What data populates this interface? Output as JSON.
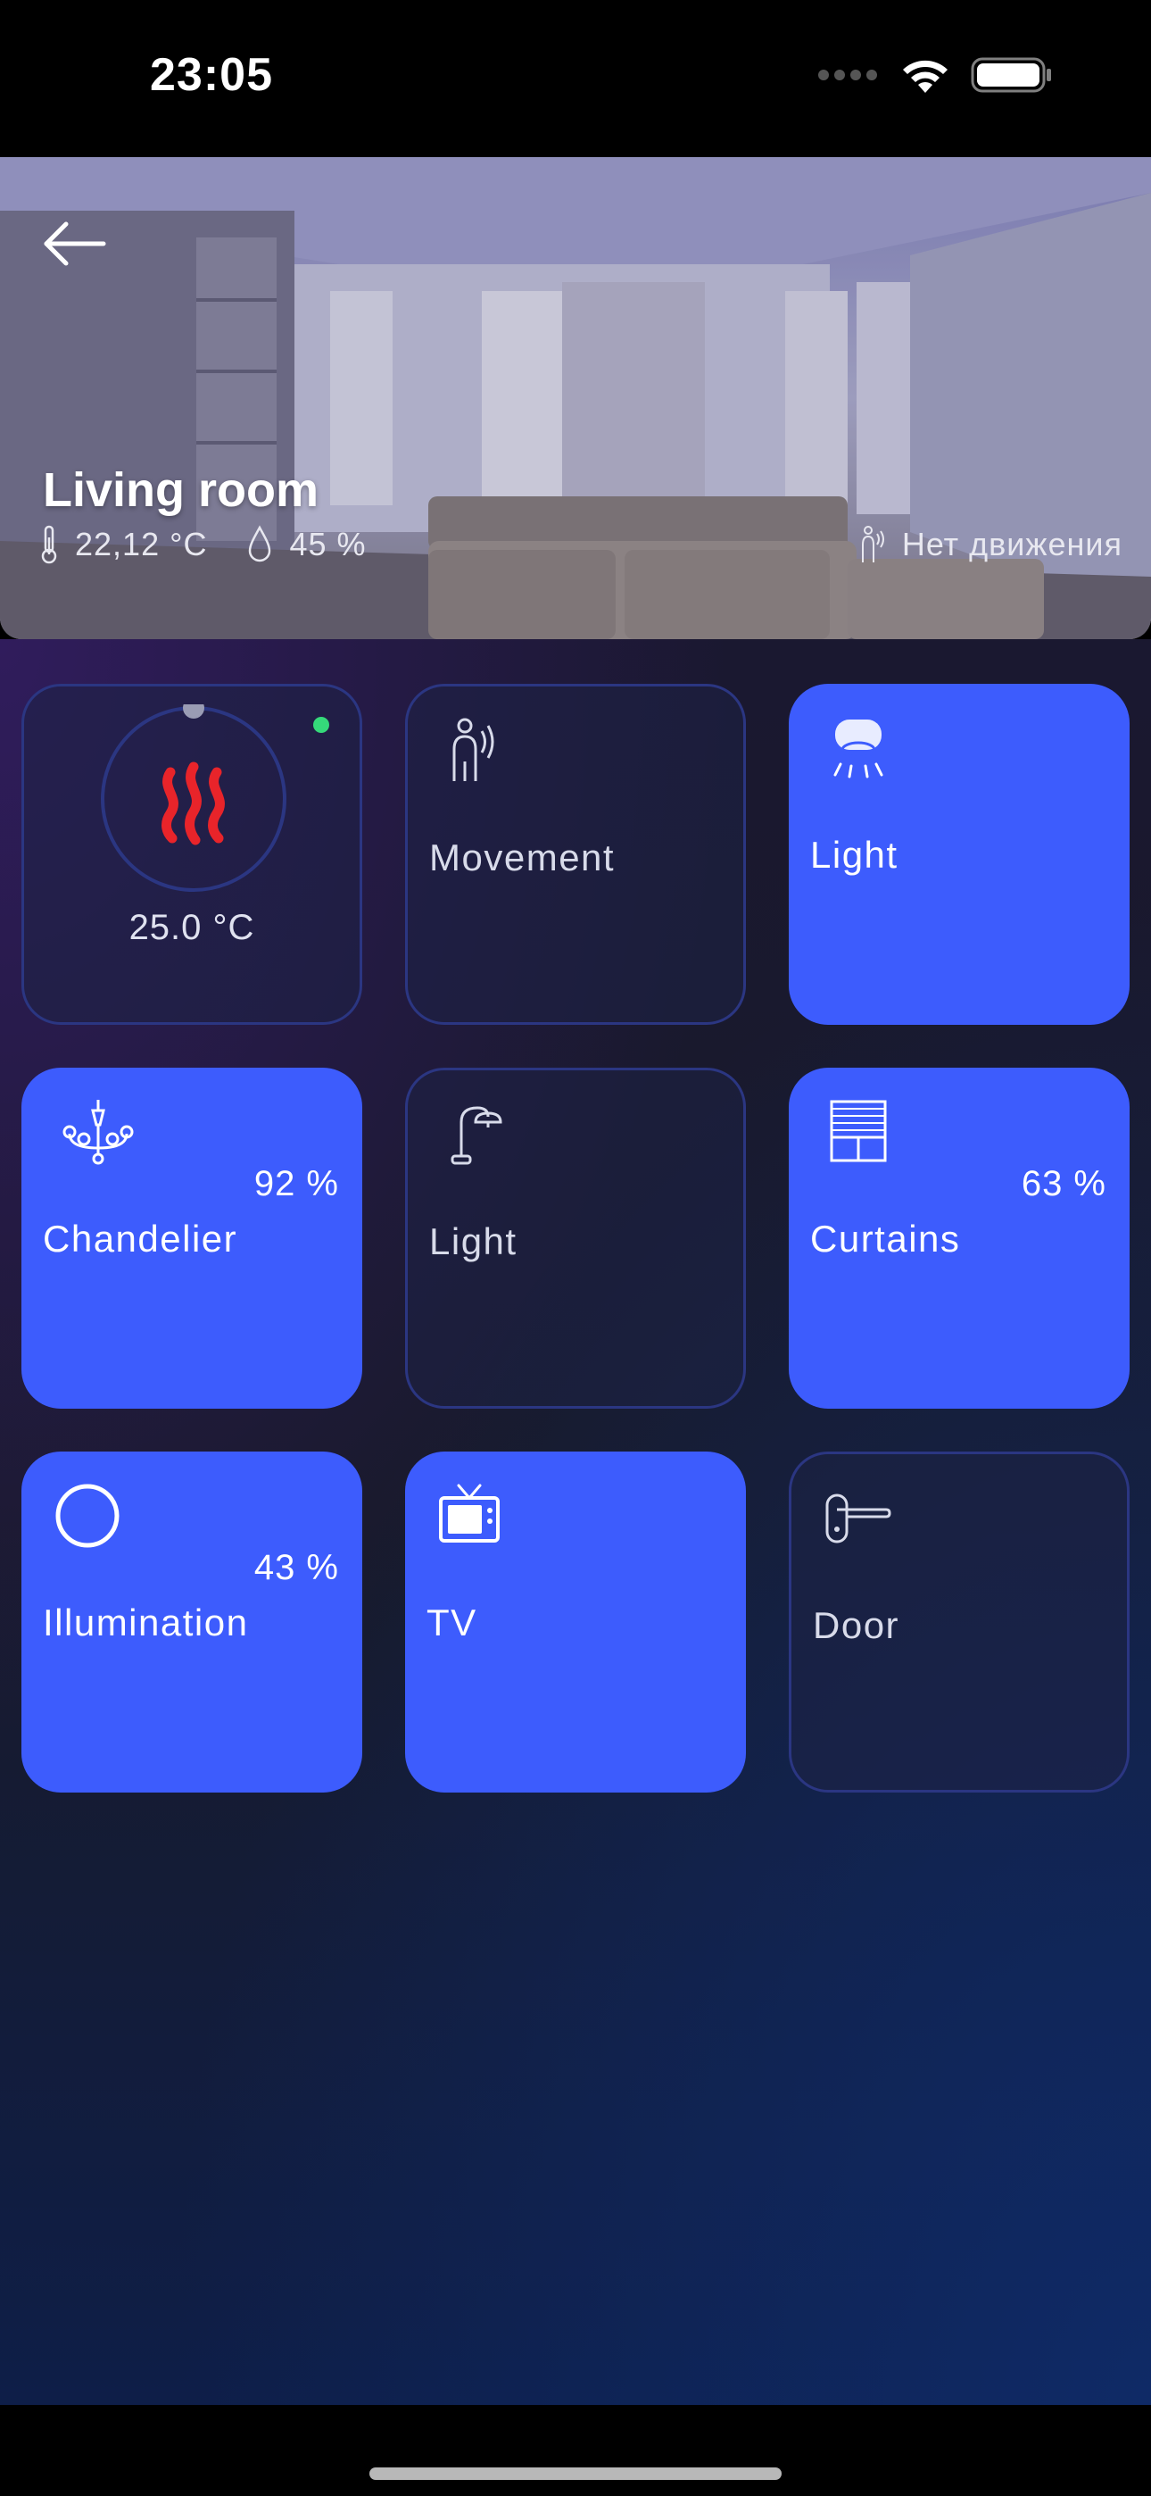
{
  "status_bar": {
    "time": "23:05"
  },
  "header": {
    "title": "Living room",
    "temperature": "22,12 °C",
    "humidity": "45 %",
    "motion_status": "Нет движения"
  },
  "tiles": {
    "thermostat": {
      "temperature": "25.0 °C",
      "icon": "heater-icon",
      "status_color": "#35d97a"
    },
    "movement": {
      "label": "Movement",
      "icon": "motion-sensor-icon",
      "state": "off"
    },
    "ceiling_light": {
      "label": "Light",
      "icon": "ceiling-light-icon",
      "state": "on"
    },
    "chandelier": {
      "label": "Chandelier",
      "value": "92 %",
      "icon": "chandelier-icon",
      "state": "on"
    },
    "lamp_light": {
      "label": "Light",
      "icon": "floor-lamp-icon",
      "state": "off"
    },
    "curtains": {
      "label": "Curtains",
      "value": "63 %",
      "icon": "curtains-icon",
      "state": "on"
    },
    "illumination": {
      "label": "Illumination",
      "value": "43 %",
      "icon": "circle-icon",
      "state": "on"
    },
    "tv": {
      "label": "TV",
      "icon": "tv-icon",
      "state": "on"
    },
    "door": {
      "label": "Door",
      "icon": "door-handle-icon",
      "state": "off"
    }
  },
  "colors": {
    "tile_on": "#3d5cfd",
    "tile_off_border": "#2b3682",
    "heater": "#e8242a"
  }
}
